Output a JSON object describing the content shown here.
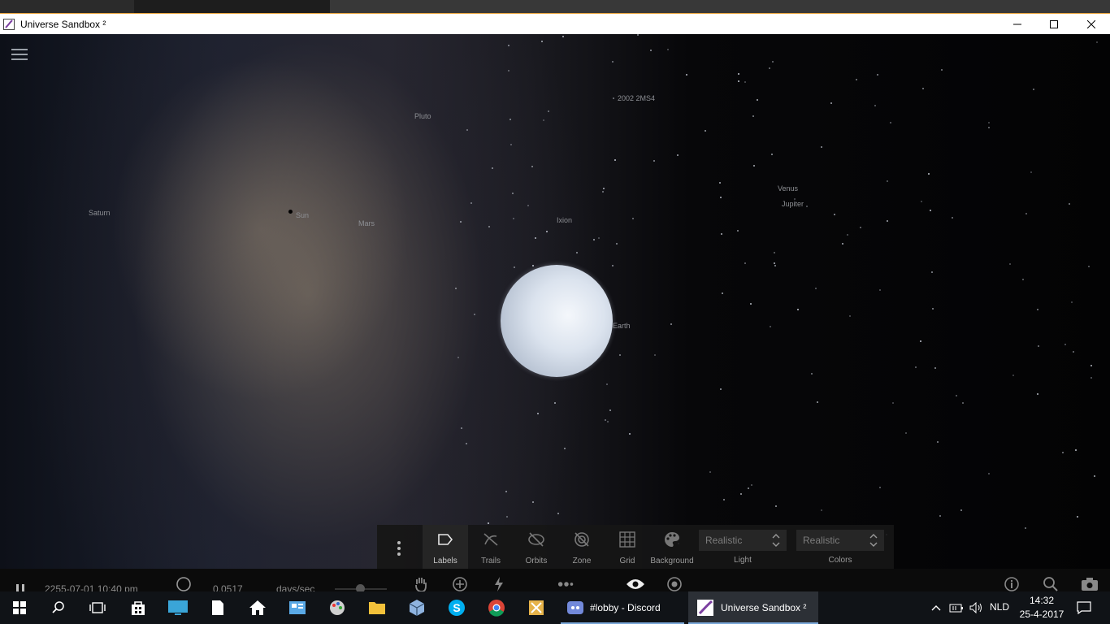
{
  "window": {
    "title": "Universe Sandbox ²"
  },
  "labels": {
    "obj_2002": "2002 2MS4",
    "pluto": "Pluto",
    "saturn": "Saturn",
    "sun": "Sun",
    "mars": "Mars",
    "ixion": "Ixion",
    "venus": "Venus",
    "jupiter": "Jupiter",
    "earth": "Earth"
  },
  "view_panel": {
    "tools": [
      {
        "label": "Labels",
        "icon": "tag-icon",
        "active": true
      },
      {
        "label": "Trails",
        "icon": "trails-off-icon"
      },
      {
        "label": "Orbits",
        "icon": "orbits-off-icon"
      },
      {
        "label": "Zone",
        "icon": "zone-off-icon"
      },
      {
        "label": "Grid",
        "icon": "grid-icon"
      },
      {
        "label": "Background",
        "icon": "palette-icon"
      }
    ],
    "light": {
      "value": "Realistic",
      "caption": "Light"
    },
    "colors": {
      "value": "Realistic",
      "caption": "Colors"
    }
  },
  "status_bar": {
    "date": "2255-07-01 10:40 pm",
    "speed": "0.0517",
    "speed_unit": "days/sec"
  },
  "taskbar": {
    "apps": [
      {
        "label": "#lobby - Discord"
      },
      {
        "label": "Universe Sandbox ²"
      }
    ],
    "language": "NLD",
    "time": "14:32",
    "date": "25-4-2017"
  }
}
